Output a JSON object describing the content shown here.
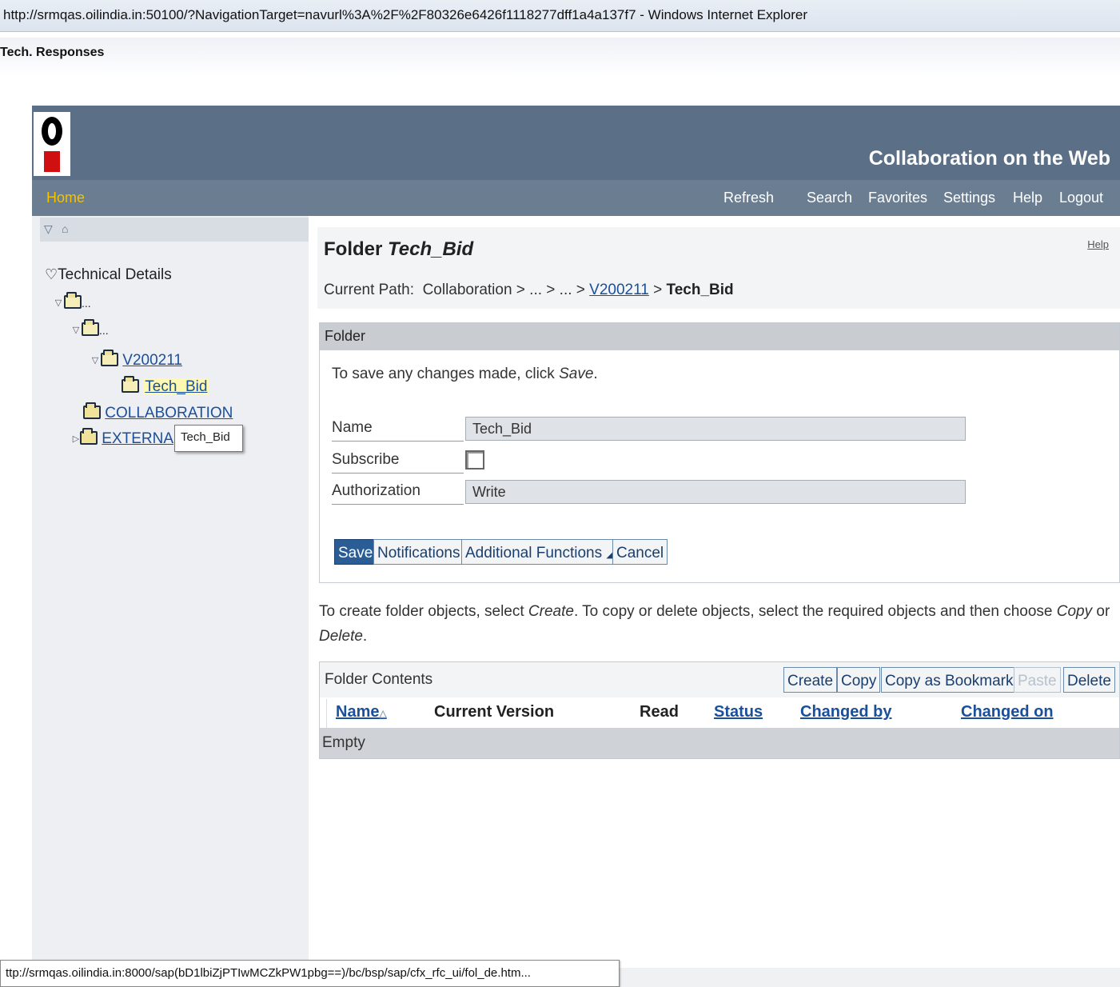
{
  "window": {
    "title": "http://srmqas.oilindia.in:50100/?NavigationTarget=navurl%3A%2F%2F80326e6426f1118277dff1a4a137f7 - Windows Internet Explorer"
  },
  "menubar": {
    "text": "Tech. Responses"
  },
  "banner": {
    "title": "Collaboration on the Web",
    "logo": "oil-india-logo"
  },
  "nav": {
    "home": "Home",
    "links": [
      "Refresh",
      "Search",
      "Favorites",
      "Settings",
      "Help",
      "Logout"
    ]
  },
  "sidebar": {
    "root": "Technical Details",
    "ellipsis1": "...",
    "ellipsis2": "...",
    "v_folder": "V200211",
    "selected_folder": "Tech_Bid",
    "collaboration": "COLLABORATION",
    "external": "EXTERNA",
    "tooltip": "Tech_Bid"
  },
  "content": {
    "title_prefix": "Folder",
    "title_name": "Tech_Bid",
    "help": "Help",
    "path_label": "Current Path:",
    "path_start": "Collaboration > ... > ... >",
    "path_link": "V200211",
    "path_sep": ">",
    "path_current": "Tech_Bid"
  },
  "folder_panel": {
    "header": "Folder",
    "info_prefix": "To save any changes made, click",
    "info_em": "Save",
    "info_suffix": ".",
    "name_label": "Name",
    "name_value": "Tech_Bid",
    "subscribe_label": "Subscribe",
    "subscribe_checked": false,
    "auth_label": "Authorization",
    "auth_value": "Write",
    "buttons": {
      "save": "Save",
      "notifications": "Notifications",
      "additional": "Additional Functions",
      "cancel": "Cancel"
    }
  },
  "instructions": {
    "p1": "To create folder objects, select",
    "e1": "Create",
    "p2": ". To copy or delete objects, select the required objects and then choose",
    "e2": "Copy",
    "p3": "or",
    "e3": "Delete",
    "p4": "."
  },
  "folder_contents": {
    "title": "Folder Contents",
    "buttons": [
      "Create",
      "Copy",
      "Copy as Bookmark",
      "Paste",
      "Delete"
    ],
    "columns": [
      "Name",
      "Current Version",
      "Read",
      "Status",
      "Changed by",
      "Changed on"
    ],
    "empty": "Empty"
  },
  "statusbar": {
    "url": "ttp://srmqas.oilindia.in:8000/sap(bD1lbiZjPTIwMCZkPW1pbg==)/bc/bsp/sap/cfx_rfc_ui/fol_de.htm..."
  },
  "colors": {
    "banner": "#5b7086",
    "nav": "#6a7d91",
    "home_accent": "#f3c300",
    "link": "#1a4f9c",
    "primary_button": "#2a5d95"
  }
}
